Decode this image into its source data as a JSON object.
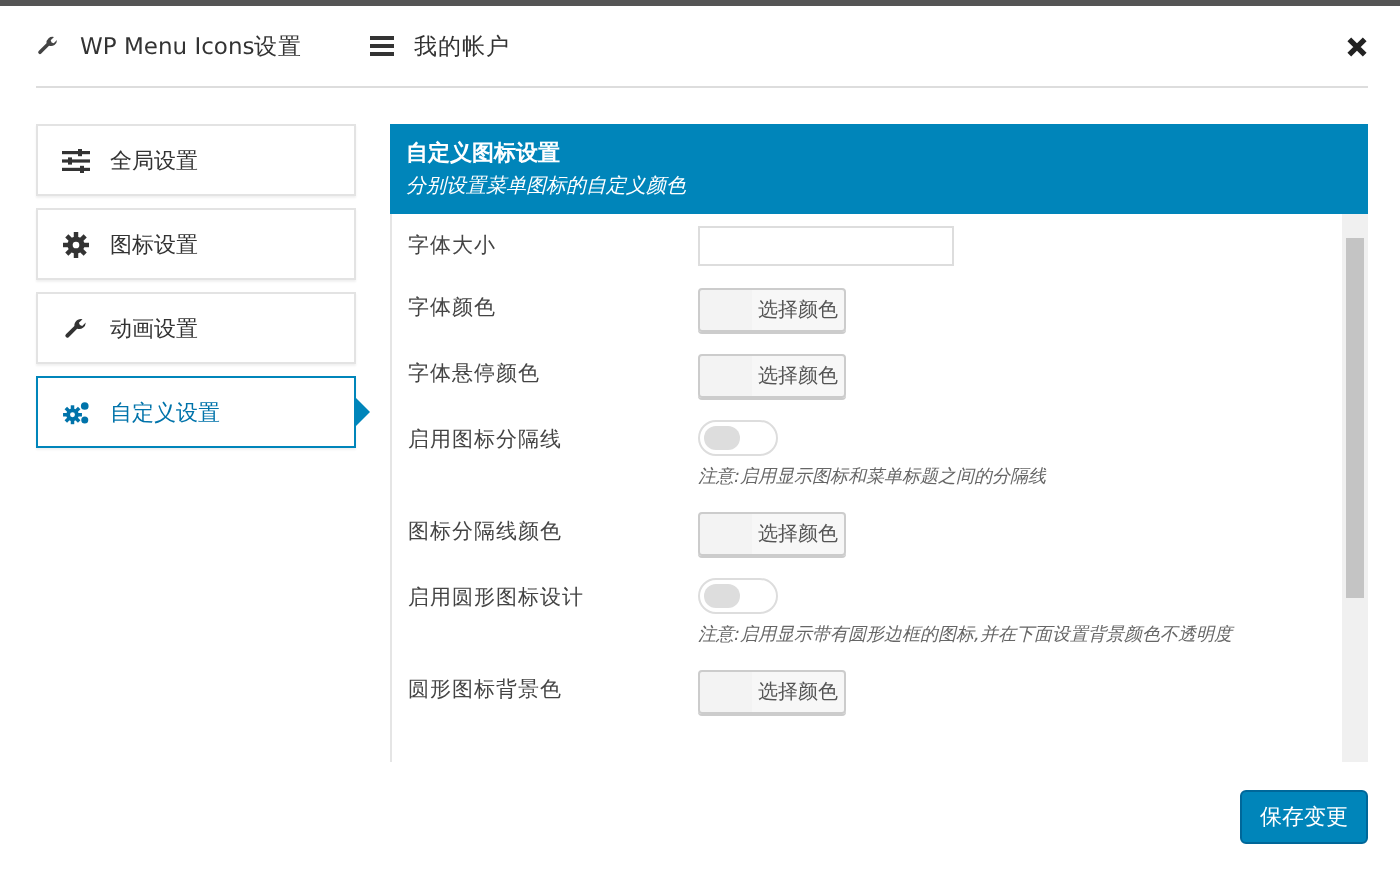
{
  "header": {
    "title": "WP Menu Icons设置",
    "account": "我的帐户"
  },
  "sidebar": {
    "items": [
      {
        "label": "全局设置",
        "kind": "sliders",
        "selected": false
      },
      {
        "label": "图标设置",
        "kind": "gear",
        "selected": false
      },
      {
        "label": "动画设置",
        "kind": "wrench",
        "selected": false
      },
      {
        "label": "自定义设置",
        "kind": "gears",
        "selected": true
      }
    ]
  },
  "panel": {
    "title": "自定义图标设置",
    "subtitle": "分别设置菜单图标的自定义颜色",
    "rows": [
      {
        "kind": "text",
        "label": "字体大小"
      },
      {
        "kind": "color",
        "label": "字体颜色",
        "button": "选择颜色"
      },
      {
        "kind": "color",
        "label": "字体悬停颜色",
        "button": "选择颜色"
      },
      {
        "kind": "toggle",
        "label": "启用图标分隔线",
        "on": false,
        "note": "注意:启用显示图标和菜单标题之间的分隔线"
      },
      {
        "kind": "color",
        "label": "图标分隔线颜色",
        "button": "选择颜色"
      },
      {
        "kind": "toggle",
        "label": "启用圆形图标设计",
        "on": false,
        "note": "注意:启用显示带有圆形边框的图标,并在下面设置背景颜色不透明度"
      },
      {
        "kind": "color",
        "label": "圆形图标背景色",
        "button": "选择颜色"
      }
    ]
  },
  "save_button": "保存变更"
}
